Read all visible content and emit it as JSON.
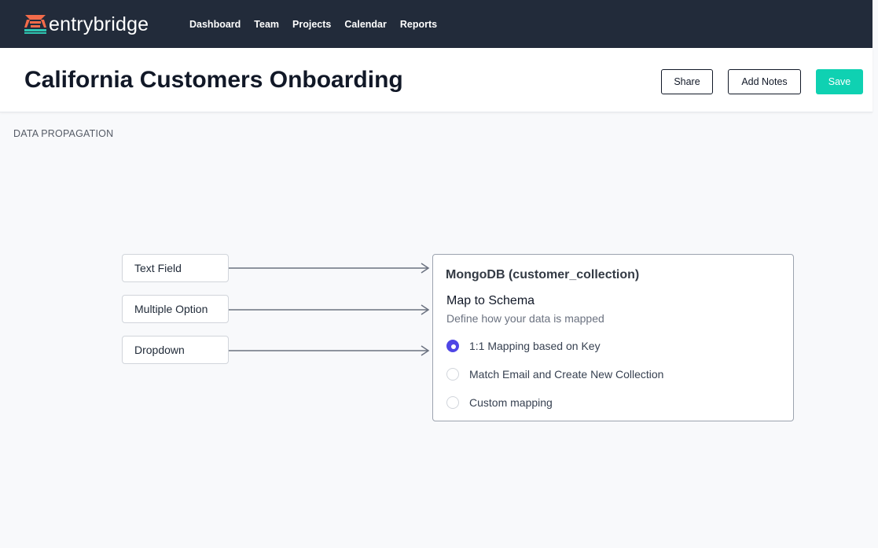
{
  "brand": {
    "name": "entrybridge",
    "logo_colors": {
      "orange": "#f26b4a",
      "teal": "#2ec8b3"
    }
  },
  "nav": {
    "items": [
      "Dashboard",
      "Team",
      "Projects",
      "Calendar",
      "Reports"
    ]
  },
  "header": {
    "title": "California Customers Onboarding",
    "share_label": "Share",
    "notes_label": "Add Notes",
    "save_label": "Save"
  },
  "section": {
    "label": "DATA PROPAGATION"
  },
  "fields": [
    "Text Field",
    "Multiple Option",
    "Dropdown"
  ],
  "card": {
    "title": "MongoDB (customer_collection)",
    "subtitle": "Map to Schema",
    "description": "Define how your data is mapped",
    "options": [
      {
        "label": "1:1 Mapping based on Key",
        "selected": true
      },
      {
        "label": "Match Email and Create New Collection",
        "selected": false
      },
      {
        "label": "Custom mapping",
        "selected": false
      }
    ]
  },
  "colors": {
    "nav_bg": "#222b3a",
    "accent": "#0fd1b2",
    "radio_selected": "#4f46e5"
  }
}
